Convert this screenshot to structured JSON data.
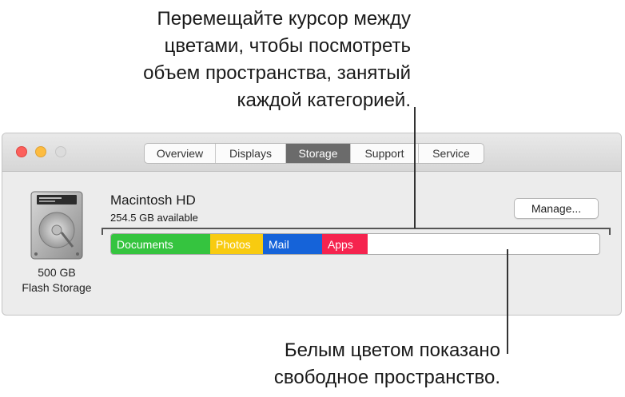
{
  "callouts": {
    "top": "Перемещайте курсор между\nцветами, чтобы посмотреть\nобъем пространства, занятый\nкаждой категорией.",
    "bottom": "Белым цветом показано\nсвободное пространство."
  },
  "window": {
    "tabs": [
      {
        "label": "Overview",
        "active": false
      },
      {
        "label": "Displays",
        "active": false
      },
      {
        "label": "Storage",
        "active": true
      },
      {
        "label": "Support",
        "active": false
      },
      {
        "label": "Service",
        "active": false
      }
    ],
    "disk": {
      "capacity": "500 GB",
      "type": "Flash Storage",
      "name": "Macintosh HD",
      "available": "254.5 GB available"
    },
    "manage_label": "Manage...",
    "segments": [
      {
        "label": "Documents",
        "color": "#35c43f",
        "fraction": 0.203
      },
      {
        "label": "Photos",
        "color": "#f8cb10",
        "fraction": 0.108
      },
      {
        "label": "Mail",
        "color": "#1563d9",
        "fraction": 0.121
      },
      {
        "label": "Apps",
        "color": "#f5234e",
        "fraction": 0.094
      }
    ]
  }
}
